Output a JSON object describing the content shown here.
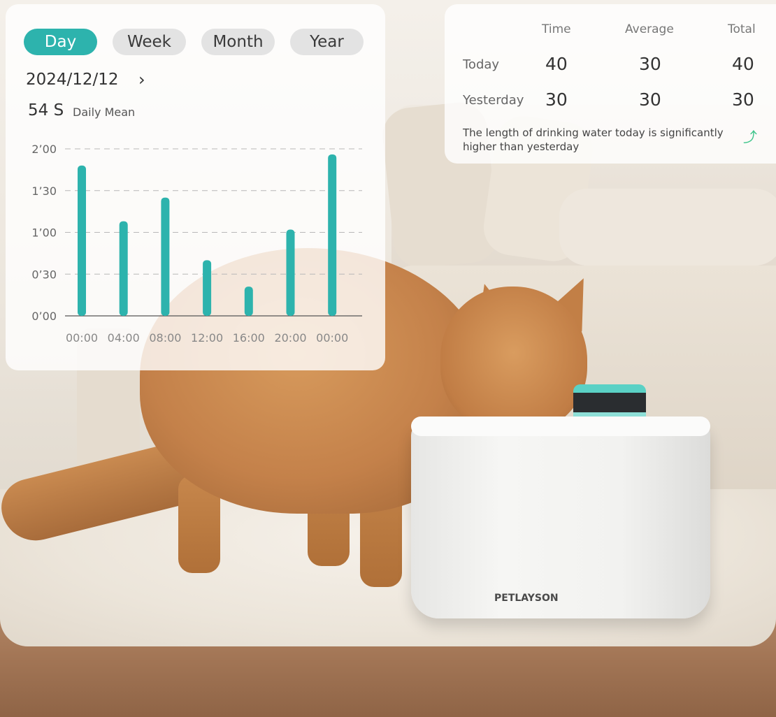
{
  "tabs": [
    {
      "label": "Day",
      "active": true
    },
    {
      "label": "Week",
      "active": false
    },
    {
      "label": "Month",
      "active": false
    },
    {
      "label": "Year",
      "active": false
    }
  ],
  "date": "2024/12/12",
  "date_next_icon": "chevron-right-icon",
  "daily_mean": {
    "value": "54 S",
    "label": "Daily Mean"
  },
  "chart_data": {
    "type": "bar",
    "categories": [
      "00:00",
      "04:00",
      "08:00",
      "12:00",
      "16:00",
      "20:00",
      "00:00"
    ],
    "values": [
      108,
      68,
      85,
      40,
      21,
      62,
      116
    ],
    "value_unit": "seconds",
    "y_ticks": [
      "0’00",
      "0’30",
      "1’00",
      "1’30",
      "2’00"
    ],
    "ylim": [
      0,
      120
    ],
    "grid": true,
    "bar_color": "#2db3ad"
  },
  "stats": {
    "headers": [
      "Time",
      "Average",
      "Total"
    ],
    "rows": [
      {
        "label": "Today",
        "values": [
          "40",
          "30",
          "40"
        ]
      },
      {
        "label": "Yesterday",
        "values": [
          "30",
          "30",
          "30"
        ]
      }
    ],
    "note": "The length of drinking water today is significantly higher than yesterday",
    "trend_icon": "trend-up-arrow-icon",
    "trend_color": "#3cc48a"
  },
  "brand": "PETLAYSON",
  "colors": {
    "accent": "#2db3ad"
  }
}
